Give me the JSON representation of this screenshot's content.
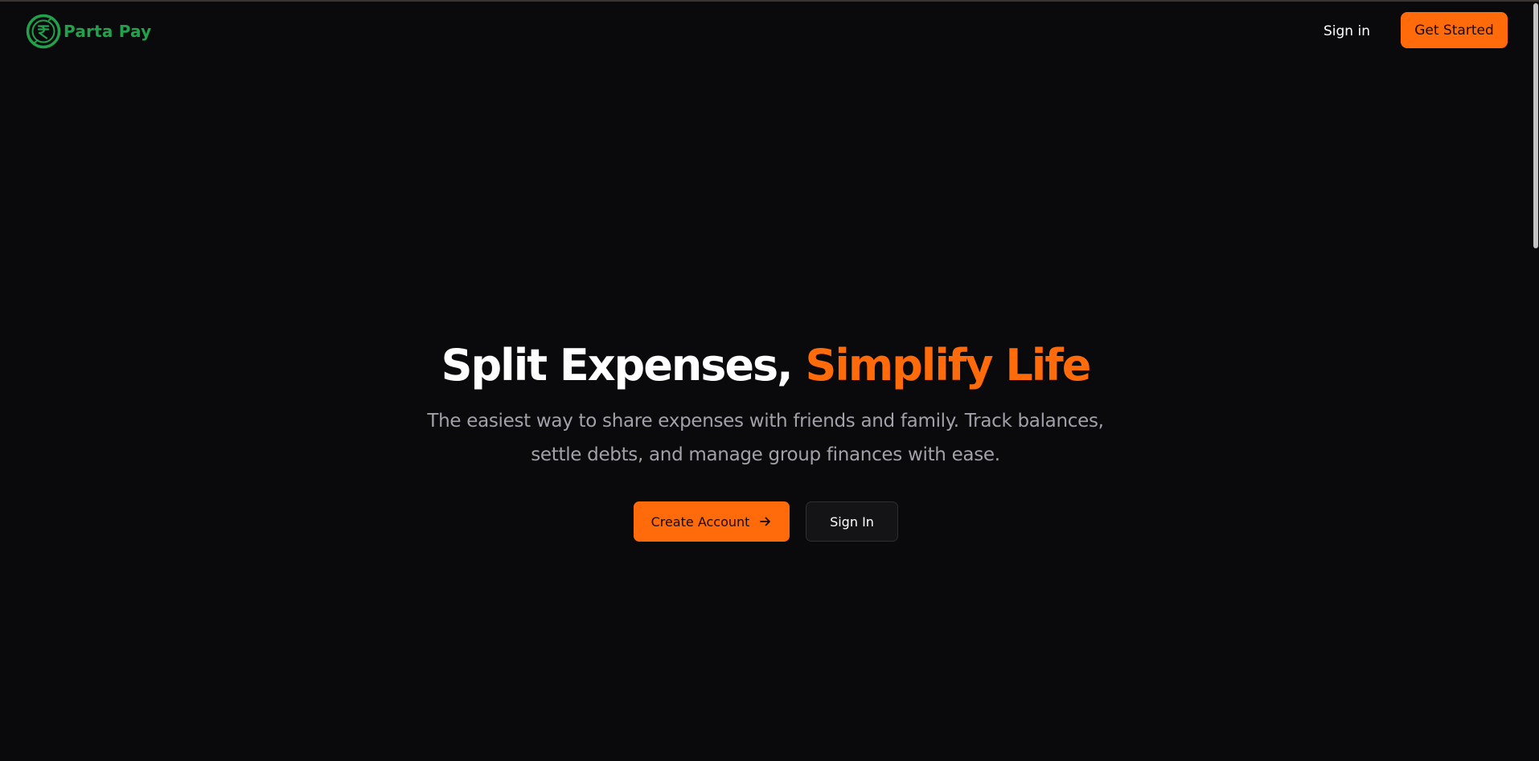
{
  "brand": {
    "name": "Parta Pay",
    "icon": "rupee-circle-icon",
    "color": "#22a04b"
  },
  "nav": {
    "signin_label": "Sign in",
    "get_started_label": "Get Started"
  },
  "hero": {
    "title_part1": "Split Expenses, ",
    "title_part2": "Simplify Life",
    "subtitle": "The easiest way to share expenses with friends and family. Track balances, settle debts, and manage group finances with ease.",
    "create_account_label": "Create Account",
    "create_account_icon": "arrow-right-icon",
    "signin_label": "Sign In"
  },
  "colors": {
    "background": "#0a0a0c",
    "accent": "#ff6a0a",
    "muted_text": "#a1a1aa"
  }
}
